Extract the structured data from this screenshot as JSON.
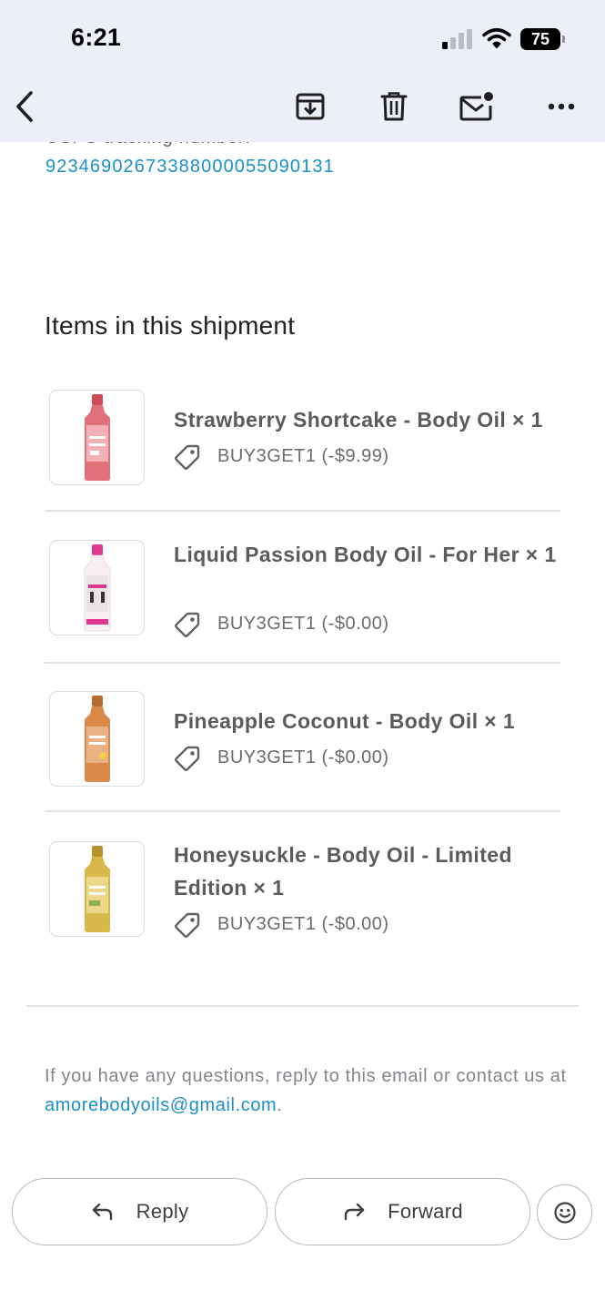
{
  "status_bar": {
    "time": "6:21",
    "battery": "75"
  },
  "toolbar": {
    "back_icon": "chevron-left-icon",
    "archive_icon": "archive-icon",
    "delete_icon": "trash-icon",
    "unread_icon": "mark-unread-icon",
    "more_icon": "more-horizontal-icon"
  },
  "email": {
    "tracking_label": "USPS tracking number:",
    "tracking_number": "9234690267338800005509013​1",
    "section_title": "Items in this shipment",
    "items": [
      {
        "name": "Strawberry Shortcake - Body Oil × 1",
        "discount": "BUY3GET1 (-$9.99)",
        "bottle_color": "#e0707a",
        "cap_color": "#d04a56",
        "label_color": "#f3b1b6"
      },
      {
        "name": "Liquid Passion Body Oil - For Her × 1",
        "discount": "BUY3GET1 (-$0.00)",
        "bottle_color": "#f6eef2",
        "cap_color": "#e0368f",
        "label_color": "#e8e4e8"
      },
      {
        "name": "Pineapple Coconut - Body Oil × 1",
        "discount": "BUY3GET1 (-$0.00)",
        "bottle_color": "#d9894a",
        "cap_color": "#b86a2c",
        "label_color": "#eab184"
      },
      {
        "name": "Honeysuckle - Body Oil - Limited Edition × 1",
        "discount": "BUY3GET1 (-$0.00)",
        "bottle_color": "#d8b84a",
        "cap_color": "#b9932a",
        "label_color": "#ecd68a"
      }
    ],
    "footer_prefix": "If you have any questions, reply to this email or contact us at ",
    "footer_email": "amorebodyoils@gmail.com",
    "footer_suffix": "."
  },
  "actions": {
    "reply_label": "Reply",
    "forward_label": "Forward",
    "emoji_icon": "smiley-icon"
  },
  "colors": {
    "link": "#1a8fc9",
    "header_bg": "#eceff5"
  }
}
